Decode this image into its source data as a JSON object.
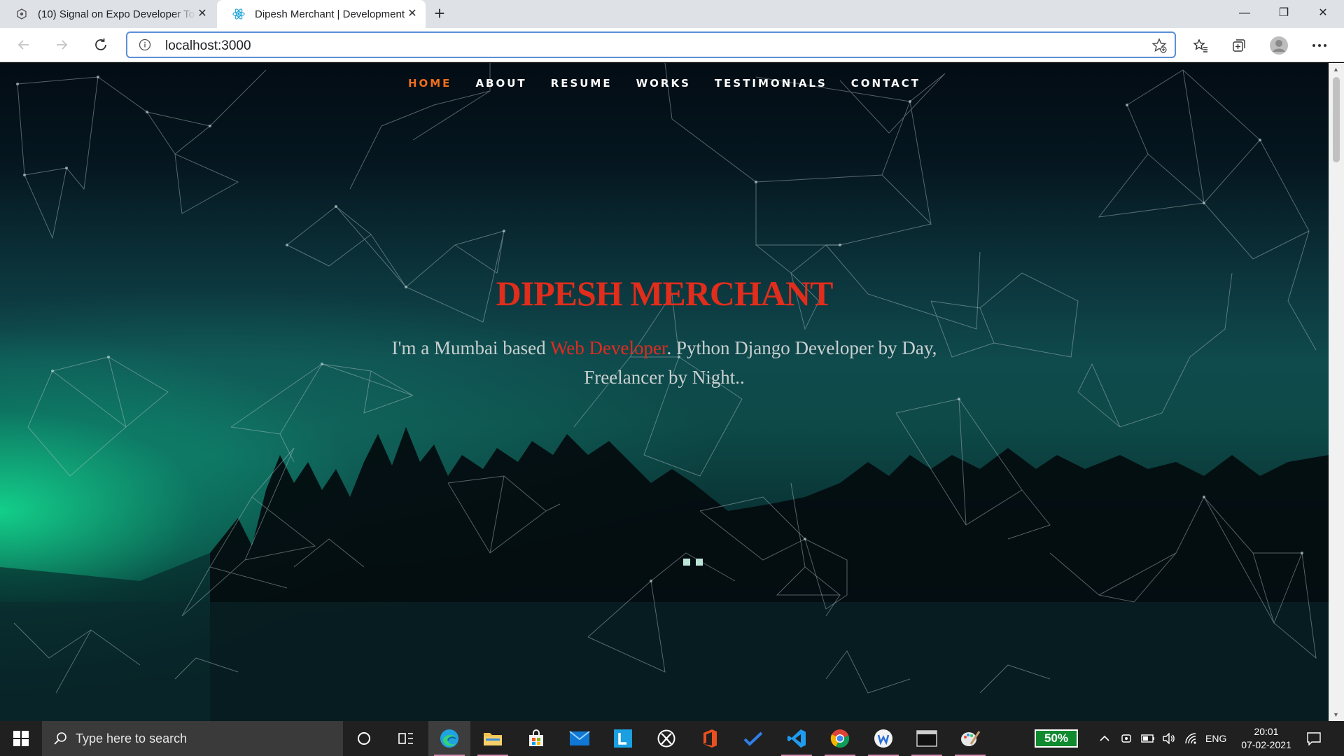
{
  "browser": {
    "tabs": [
      {
        "title": "(10) Signal on Expo Developer To",
        "active": false
      },
      {
        "title": "Dipesh Merchant | Development",
        "active": true
      }
    ],
    "address": "localhost:3000"
  },
  "site": {
    "nav": [
      "HOME",
      "ABOUT",
      "RESUME",
      "WORKS",
      "TESTIMONIALS",
      "CONTACT"
    ],
    "active_nav": "HOME",
    "name": "DIPESH MERCHANT",
    "intro_before": "I'm a Mumbai based ",
    "intro_highlight": "Web Developer",
    "intro_after": ". Python Django Developer by Day, Freelancer by Night..",
    "accent_color": "#e02d1c",
    "nav_active_color": "#f06d1c"
  },
  "taskbar": {
    "search_placeholder": "Type here to search",
    "apps": [
      "cortana-icon",
      "task-view-icon",
      "edge-icon",
      "file-explorer-icon",
      "store-icon",
      "mail-icon",
      "app-l-icon",
      "xbox-icon",
      "office-icon",
      "todo-icon",
      "vscode-icon",
      "chrome-icon",
      "app-w-icon",
      "terminal-icon",
      "paint-icon"
    ],
    "battery": "50%",
    "language": "ENG",
    "time": "20:01",
    "date": "07-02-2021"
  }
}
